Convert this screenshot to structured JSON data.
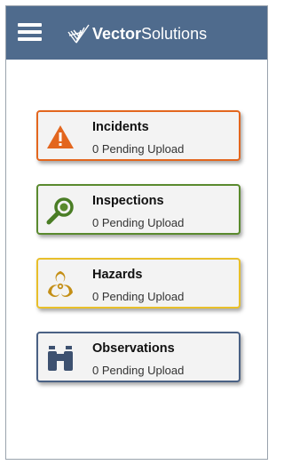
{
  "header": {
    "brand_bold": "Vector",
    "brand_regular": "Solutions",
    "bg_color": "#4f6b8d"
  },
  "cards": [
    {
      "title": "Incidents",
      "status": "0 Pending Upload",
      "icon": "warning-triangle-icon",
      "color": "#e3661e"
    },
    {
      "title": "Inspections",
      "status": "0 Pending Upload",
      "icon": "magnifier-icon",
      "color": "#5a8a2e"
    },
    {
      "title": "Hazards",
      "status": "0 Pending Upload",
      "icon": "biohazard-icon",
      "color": "#e8bf2a"
    },
    {
      "title": "Observations",
      "status": "0 Pending Upload",
      "icon": "binoculars-icon",
      "color": "#4a6184"
    }
  ]
}
